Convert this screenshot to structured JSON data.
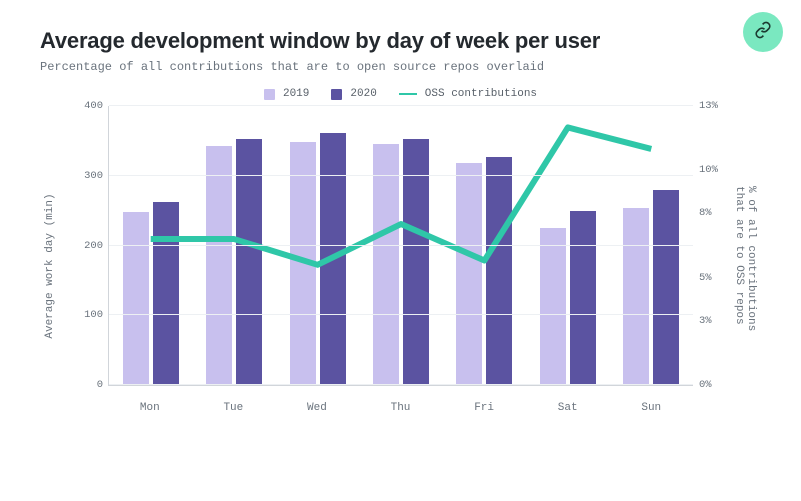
{
  "header": {
    "title": "Average development window by day of week per user",
    "subtitle": "Percentage of all contributions that are to open source repos overlaid"
  },
  "legend": {
    "s2019": "2019",
    "s2020": "2020",
    "oss": "OSS contributions"
  },
  "axes": {
    "ylabel_left": "Average work day (min)",
    "ylabel_right": "% of all contributions that are to OSS repos"
  },
  "chart_data": {
    "type": "bar",
    "categories": [
      "Mon",
      "Tue",
      "Wed",
      "Thu",
      "Fri",
      "Sat",
      "Sun"
    ],
    "series": [
      {
        "name": "2019",
        "values": [
          248,
          342,
          348,
          346,
          318,
          225,
          254
        ]
      },
      {
        "name": "2020",
        "values": [
          263,
          353,
          362,
          352,
          327,
          249,
          279
        ]
      }
    ],
    "line_series": {
      "name": "OSS contributions",
      "values": [
        6.8,
        6.8,
        5.6,
        7.5,
        5.8,
        12.0,
        11.0
      ]
    },
    "ylim_left": [
      0,
      400
    ],
    "yticks_left": [
      0,
      100,
      200,
      300,
      400
    ],
    "ylim_right": [
      0,
      13
    ],
    "yticks_right": [
      0,
      3,
      5,
      8,
      10,
      13
    ],
    "xlabel": "",
    "ylabel_left": "Average work day (min)",
    "ylabel_right": "% of all contributions that are to OSS repos",
    "title": "Average development window by day of week per user"
  }
}
